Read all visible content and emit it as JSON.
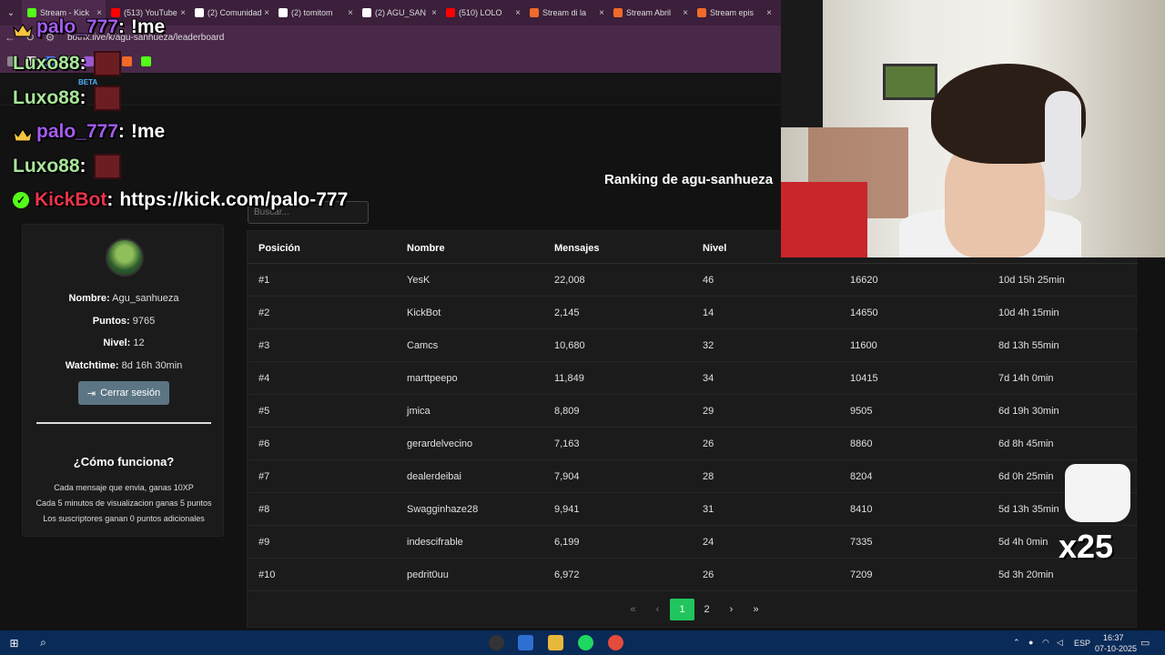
{
  "browser": {
    "tabs": [
      {
        "label": "Stream - Kick",
        "color": "#53fc18"
      },
      {
        "label": "(513) YouTube",
        "color": "#ff0000"
      },
      {
        "label": "(2) Comunidad",
        "color": "#ffffff"
      },
      {
        "label": "(2) tomitom",
        "color": "#ffffff"
      },
      {
        "label": "(2) AGU_SAN",
        "color": "#ffffff"
      },
      {
        "label": "(510) LOLO",
        "color": "#ff0000"
      },
      {
        "label": "Stream di la",
        "color": "#f06a2a"
      },
      {
        "label": "Stream Abril",
        "color": "#f06a2a"
      },
      {
        "label": "Stream epis",
        "color": "#f06a2a"
      }
    ],
    "url": "botrix.live/k/agu-sanhueza/leaderboard"
  },
  "site": {
    "beta_label": "BETA"
  },
  "chat": [
    {
      "user": "palo_777",
      "sep": ":",
      "message": "!me",
      "kind": "crown"
    },
    {
      "user": "Luxo88",
      "sep": ":",
      "message": "",
      "kind": "emote"
    },
    {
      "user": "Luxo88",
      "sep": ":",
      "message": "",
      "kind": "emote"
    },
    {
      "user": "palo_777",
      "sep": ":",
      "message": "!me",
      "kind": "crown"
    },
    {
      "user": "Luxo88",
      "sep": ":",
      "message": "",
      "kind": "emote"
    },
    {
      "user": "KickBot",
      "sep": ":",
      "message": "https://kick.com/palo-777",
      "kind": "bot"
    }
  ],
  "ranking": {
    "title": "Ranking de agu-sanhueza",
    "search_placeholder": "Buscar..."
  },
  "profile": {
    "name_label": "Nombre:",
    "name": "Agu_sanhueza",
    "points_label": "Puntos:",
    "points": "9765",
    "level_label": "Nivel:",
    "level": "12",
    "watchtime_label": "Watchtime:",
    "watchtime": "8d 16h 30min",
    "logout_label": "Cerrar sesión",
    "how_title": "¿Cómo funciona?",
    "how_lines": [
      "Cada mensaje que envia, ganas 10XP",
      "Cada 5 minutos de visualizacion ganas 5 puntos",
      "Los suscriptores ganan 0 puntos adicionales"
    ]
  },
  "table": {
    "headers": [
      "Posición",
      "Nombre",
      "Mensajes",
      "Nivel"
    ],
    "rows": [
      [
        "#1",
        "YesK",
        "22,008",
        "46",
        "16620",
        "10d 15h 25min"
      ],
      [
        "#2",
        "KickBot",
        "2,145",
        "14",
        "14650",
        "10d 4h 15min"
      ],
      [
        "#3",
        "Camcs",
        "10,680",
        "32",
        "11600",
        "8d 13h 55min"
      ],
      [
        "#4",
        "marttpeepo",
        "11,849",
        "34",
        "10415",
        "7d 14h 0min"
      ],
      [
        "#5",
        "jmica",
        "8,809",
        "29",
        "9505",
        "6d 19h 30min"
      ],
      [
        "#6",
        "gerardelvecino",
        "7,163",
        "26",
        "8860",
        "6d 8h 45min"
      ],
      [
        "#7",
        "dealerdeibai",
        "7,904",
        "28",
        "8204",
        "6d 0h 25min"
      ],
      [
        "#8",
        "Swagginhaze28",
        "9,941",
        "31",
        "8410",
        "5d 13h 35min"
      ],
      [
        "#9",
        "indescifrable",
        "6,199",
        "24",
        "7335",
        "5d 4h 0min"
      ],
      [
        "#10",
        "pedrit0uu",
        "6,972",
        "26",
        "7209",
        "5d 3h 20min"
      ]
    ],
    "pagination": {
      "first": "«",
      "prev": "‹",
      "pages": [
        "1",
        "2"
      ],
      "current": "1",
      "next": "›",
      "last": "»"
    }
  },
  "overlay": {
    "emote_count": "x25"
  },
  "taskbar": {
    "language": "ESP",
    "time": "16:37",
    "date": "07-10-2025"
  },
  "colors": {
    "accent_green": "#21c55d",
    "kick_green": "#53fc18",
    "chat_purple": "#a45cf0",
    "chat_red": "#e8344a"
  }
}
